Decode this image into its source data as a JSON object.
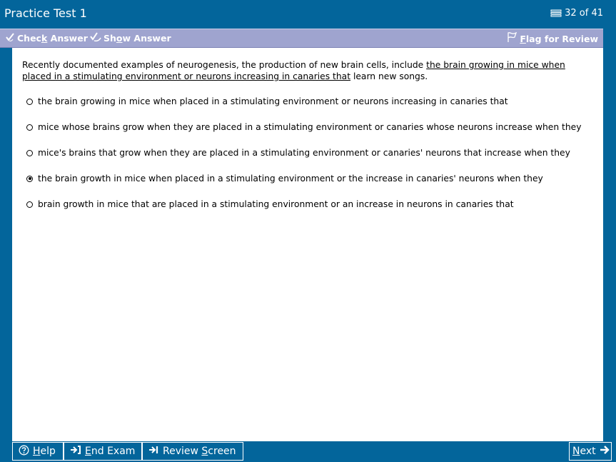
{
  "title": "Practice Test 1",
  "counter": "32 of 41",
  "toolbar": {
    "check_pre": "Chec",
    "check_key": "k",
    "check_post": " Answer",
    "show_pre": "Sh",
    "show_key": "o",
    "show_post": "w Answer",
    "flag_key": "F",
    "flag_post": "lag for Review"
  },
  "question": {
    "pre": "Recently documented examples of neurogenesis, the production of new brain cells, include ",
    "underlined": "the brain growing in mice when placed in a stimulating environment or neurons increasing in canaries that",
    "post": " learn new songs."
  },
  "options": [
    {
      "text": "the brain growing in mice when placed in a stimulating environment or neurons increasing in canaries that",
      "selected": false
    },
    {
      "text": "mice whose brains grow when they are placed in a stimulating environment or canaries whose neurons increase when they",
      "selected": false
    },
    {
      "text": "mice's brains that grow when they are placed in a stimulating environment or canaries' neurons that increase when they",
      "selected": false
    },
    {
      "text": "the brain growth in mice when placed in a stimulating environment or the increase in canaries' neurons when they",
      "selected": true
    },
    {
      "text": "brain growth in mice that are placed in a stimulating environment or an increase in neurons in canaries that",
      "selected": false
    }
  ],
  "bottom": {
    "help_key": "H",
    "help_post": "elp",
    "end_key": "E",
    "end_post": "nd Exam",
    "review_pre": "Review ",
    "review_key": "S",
    "review_post": "creen",
    "next_key": "N",
    "next_post": "ext"
  },
  "icons": {
    "counter": "stack-icon",
    "check": "check-answer-icon",
    "show": "show-answer-icon",
    "flag": "flag-icon",
    "help": "help-circle-icon",
    "end": "end-exam-icon",
    "review": "review-arrow-icon",
    "next": "arrow-right-icon"
  },
  "colors": {
    "frame": "#03659b",
    "toolbar": "#9fa4cf",
    "content": "#ffffff"
  }
}
